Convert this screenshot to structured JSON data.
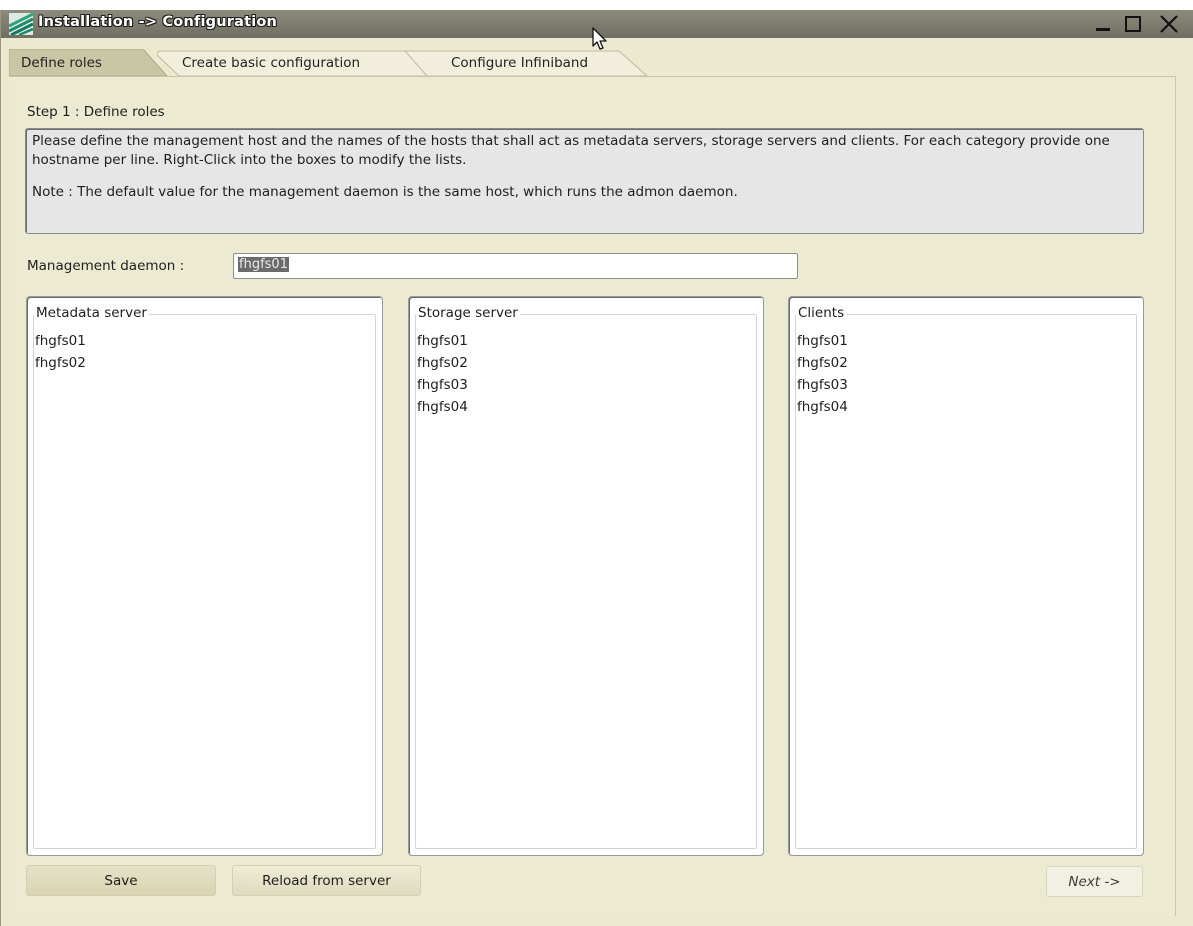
{
  "window": {
    "title": "Installation -> Configuration",
    "controls": [
      "minimize-icon",
      "maximize-icon",
      "close-icon"
    ]
  },
  "tabs": [
    {
      "label": "Define roles",
      "active": true
    },
    {
      "label": "Create basic configuration",
      "active": false
    },
    {
      "label": "Configure Infiniband",
      "active": false
    }
  ],
  "step": {
    "label": "Step 1 : Define roles"
  },
  "info": {
    "text": "Please define the management host and the names of the hosts that shall act as metadata servers, storage servers and clients. For each category provide one hostname per line. Right-Click into the boxes to modify the lists.",
    "note": "Note : The default value for the management daemon is the same host, which runs the admon daemon."
  },
  "management": {
    "label": "Management daemon :",
    "value": "fhgfs01"
  },
  "groups": {
    "metadata": {
      "title": "Metadata server",
      "hosts": [
        "fhgfs01",
        "fhgfs02"
      ]
    },
    "storage": {
      "title": "Storage server",
      "hosts": [
        "fhgfs01",
        "fhgfs02",
        "fhgfs03",
        "fhgfs04"
      ]
    },
    "clients": {
      "title": "Clients",
      "hosts": [
        "fhgfs01",
        "fhgfs02",
        "fhgfs03",
        "fhgfs04"
      ]
    }
  },
  "buttons": {
    "save": "Save",
    "reload": "Reload from server",
    "next": "Next ->"
  },
  "colors": {
    "window_bg": "#ece9cf",
    "titlebar": "#7a796c",
    "active_tab": "#c9c6a6",
    "inactive_tab": "#f1efdb"
  }
}
